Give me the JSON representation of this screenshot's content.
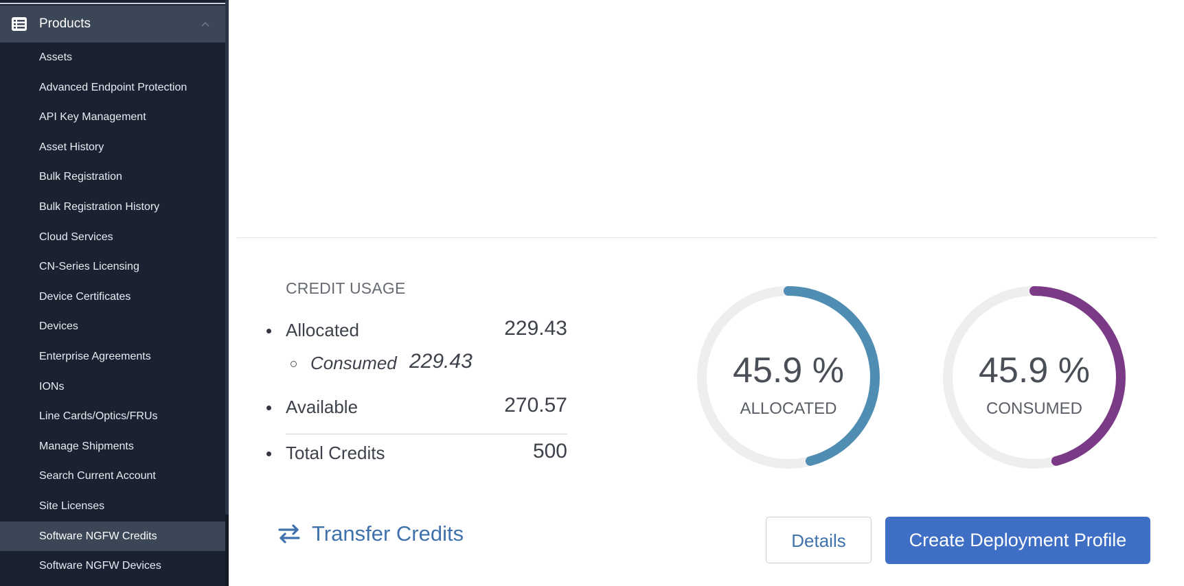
{
  "sidebar": {
    "section_title": "Products",
    "section_icon": "list-icon",
    "items": [
      {
        "label": "Assets"
      },
      {
        "label": "Advanced Endpoint Protection"
      },
      {
        "label": "API Key Management"
      },
      {
        "label": "Asset History"
      },
      {
        "label": "Bulk Registration"
      },
      {
        "label": "Bulk Registration History"
      },
      {
        "label": "Cloud Services"
      },
      {
        "label": "CN-Series Licensing"
      },
      {
        "label": "Device Certificates"
      },
      {
        "label": "Devices"
      },
      {
        "label": "Enterprise Agreements"
      },
      {
        "label": "IONs"
      },
      {
        "label": "Line Cards/Optics/FRUs"
      },
      {
        "label": "Manage Shipments"
      },
      {
        "label": "Search Current Account"
      },
      {
        "label": "Site Licenses"
      },
      {
        "label": "Software NGFW Credits",
        "active": true
      },
      {
        "label": "Software NGFW Devices"
      }
    ]
  },
  "credit_usage": {
    "title": "CREDIT USAGE",
    "allocated_label": "Allocated",
    "allocated_value": "229.43",
    "consumed_label": "Consumed",
    "consumed_value": "229.43",
    "available_label": "Available",
    "available_value": "270.57",
    "total_label": "Total Credits",
    "total_value": "500"
  },
  "gauges": [
    {
      "percent_text": "45.9 %",
      "caption": "ALLOCATED",
      "fraction": 0.459,
      "color": "#4f8db2"
    },
    {
      "percent_text": "45.9 %",
      "caption": "CONSUMED",
      "fraction": 0.459,
      "color": "#7b3a86"
    }
  ],
  "actions": {
    "transfer_label": "Transfer Credits",
    "transfer_icon": "swap-arrows-icon",
    "details_label": "Details",
    "create_label": "Create Deployment Profile"
  },
  "colors": {
    "sidebar_bg": "#1a2232",
    "accent_blue": "#3e6fc5",
    "link_blue": "#3f72ad"
  }
}
